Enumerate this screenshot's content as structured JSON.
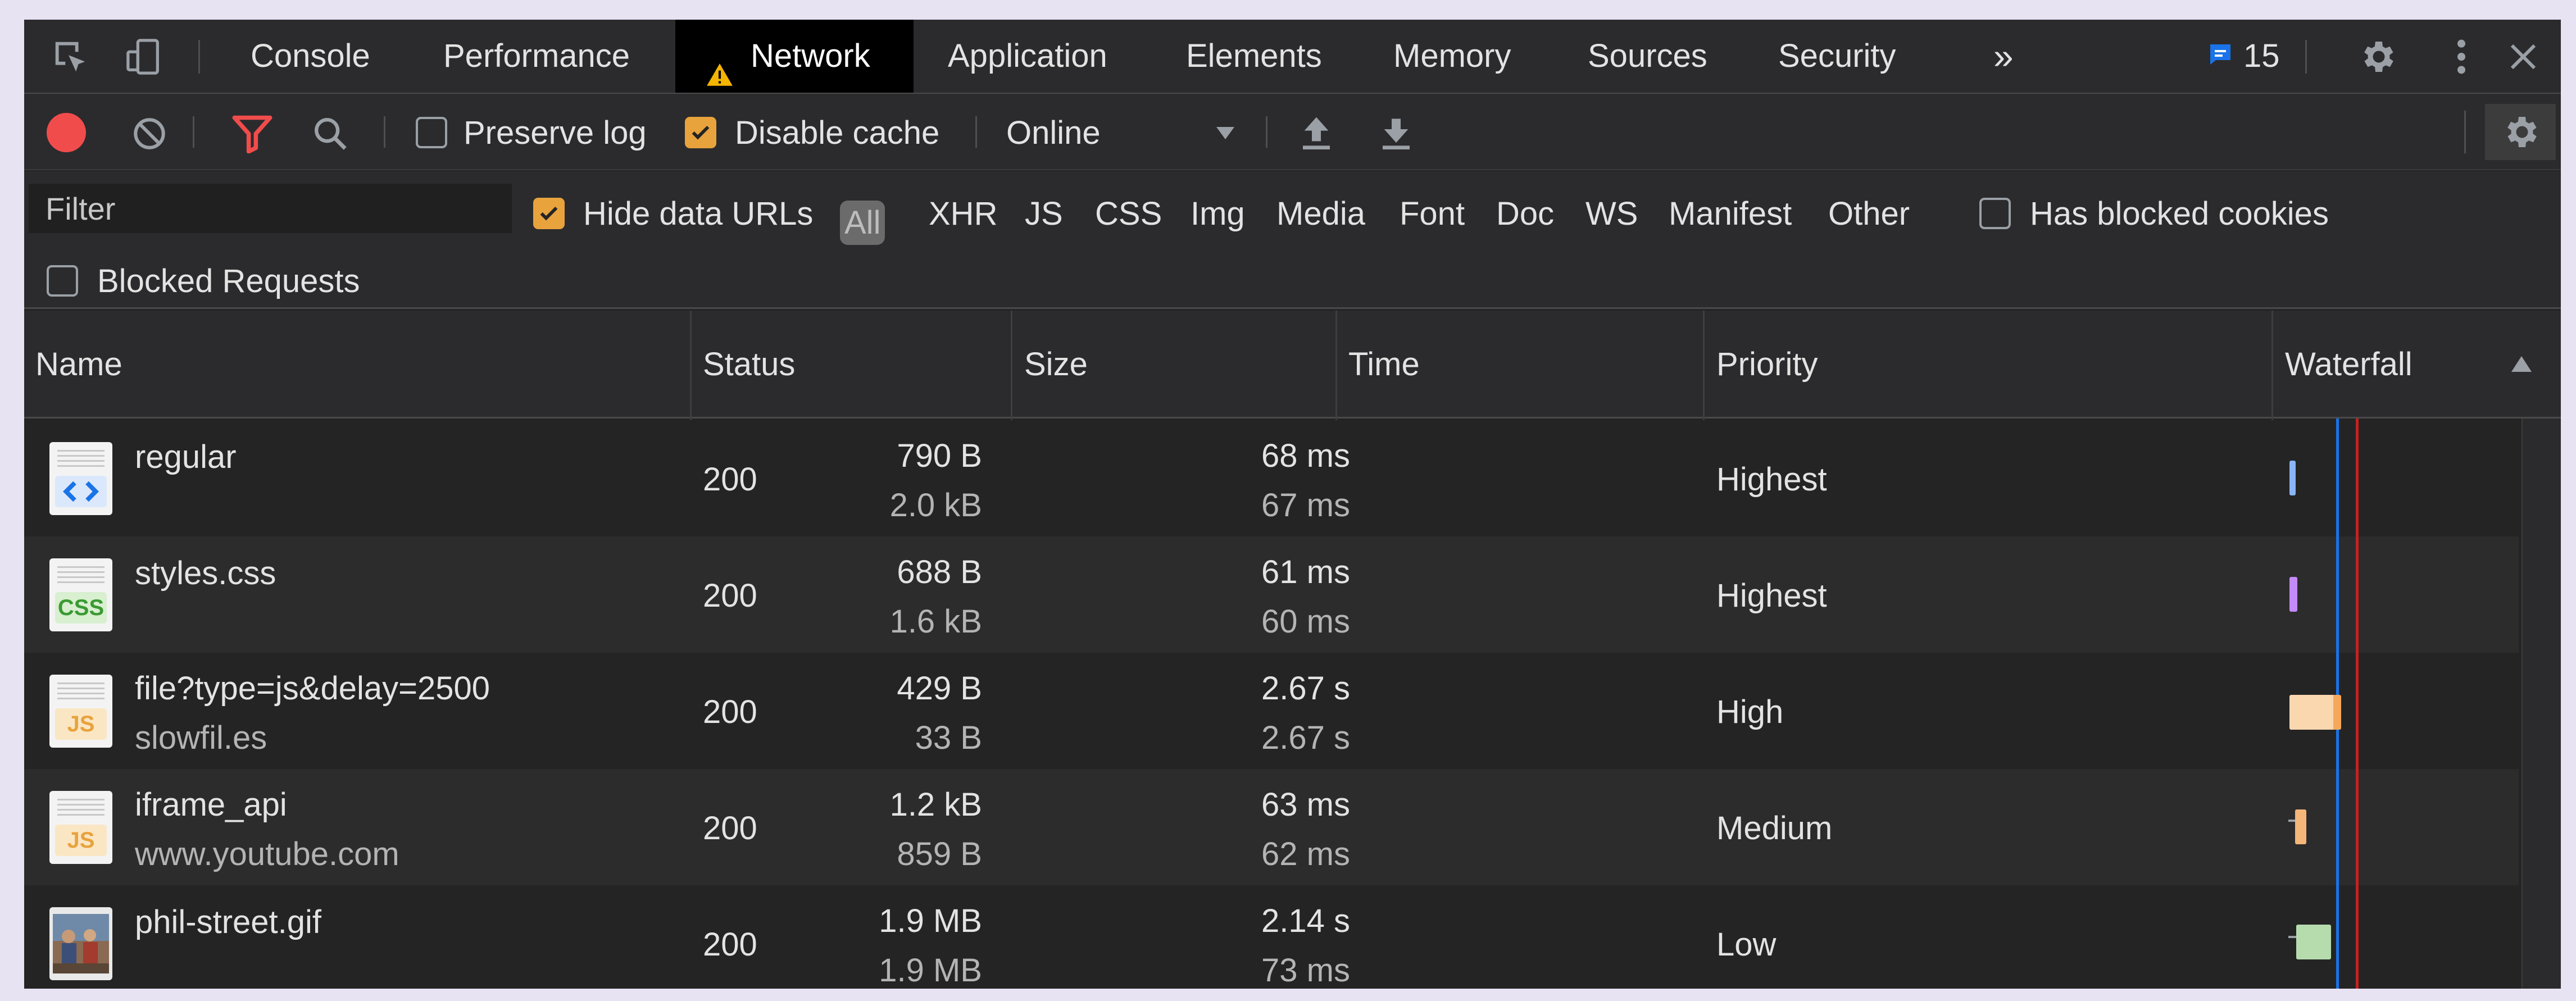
{
  "tabs": {
    "console": "Console",
    "performance": "Performance",
    "network": "Network",
    "application": "Application",
    "elements": "Elements",
    "memory": "Memory",
    "sources": "Sources",
    "security": "Security",
    "more": "»",
    "issue_count": "15"
  },
  "toolbar": {
    "preserve_log": "Preserve log",
    "preserve_log_checked": false,
    "disable_cache": "Disable cache",
    "disable_cache_checked": true,
    "throttling": "Online"
  },
  "filter": {
    "placeholder": "Filter",
    "hide_data_urls": "Hide data URLs",
    "hide_data_urls_checked": true,
    "types": [
      "All",
      "XHR",
      "JS",
      "CSS",
      "Img",
      "Media",
      "Font",
      "Doc",
      "WS",
      "Manifest",
      "Other"
    ],
    "selected_type": "All",
    "has_blocked_cookies": "Has blocked cookies",
    "blocked_requests": "Blocked Requests"
  },
  "columns": [
    "Name",
    "Status",
    "Size",
    "Time",
    "Priority",
    "Waterfall"
  ],
  "rows": [
    {
      "name": "regular",
      "domain": "",
      "icon": "html-document-icon",
      "status": "200",
      "size": "790 B",
      "resource_size": "2.0 kB",
      "time": "68 ms",
      "latency": "67 ms",
      "priority": "Highest"
    },
    {
      "name": "styles.css",
      "domain": "",
      "icon": "css-file-icon",
      "status": "200",
      "size": "688 B",
      "resource_size": "1.6 kB",
      "time": "61 ms",
      "latency": "60 ms",
      "priority": "Highest"
    },
    {
      "name": "file?type=js&delay=2500",
      "domain": "slowfil.es",
      "icon": "js-file-icon",
      "status": "200",
      "size": "429 B",
      "resource_size": "33 B",
      "time": "2.67 s",
      "latency": "2.67 s",
      "priority": "High"
    },
    {
      "name": "iframe_api",
      "domain": "www.youtube.com",
      "icon": "js-file-icon",
      "status": "200",
      "size": "1.2 kB",
      "resource_size": "859 B",
      "time": "63 ms",
      "latency": "62 ms",
      "priority": "Medium"
    },
    {
      "name": "phil-street.gif",
      "domain": "",
      "icon": "image-thumbnail-icon",
      "status": "200",
      "size": "1.9 MB",
      "resource_size": "1.9 MB",
      "time": "2.14 s",
      "latency": "73 ms",
      "priority": "Low"
    }
  ],
  "colors": {
    "record": "#f14c4c",
    "filter_active": "#f14c4c",
    "checkbox_on": "#e8a33d",
    "warning": "#f4b400",
    "issues": "#1a73e8",
    "dom_content_loaded_line": "#1a73e8",
    "load_line": "#c5221f"
  }
}
